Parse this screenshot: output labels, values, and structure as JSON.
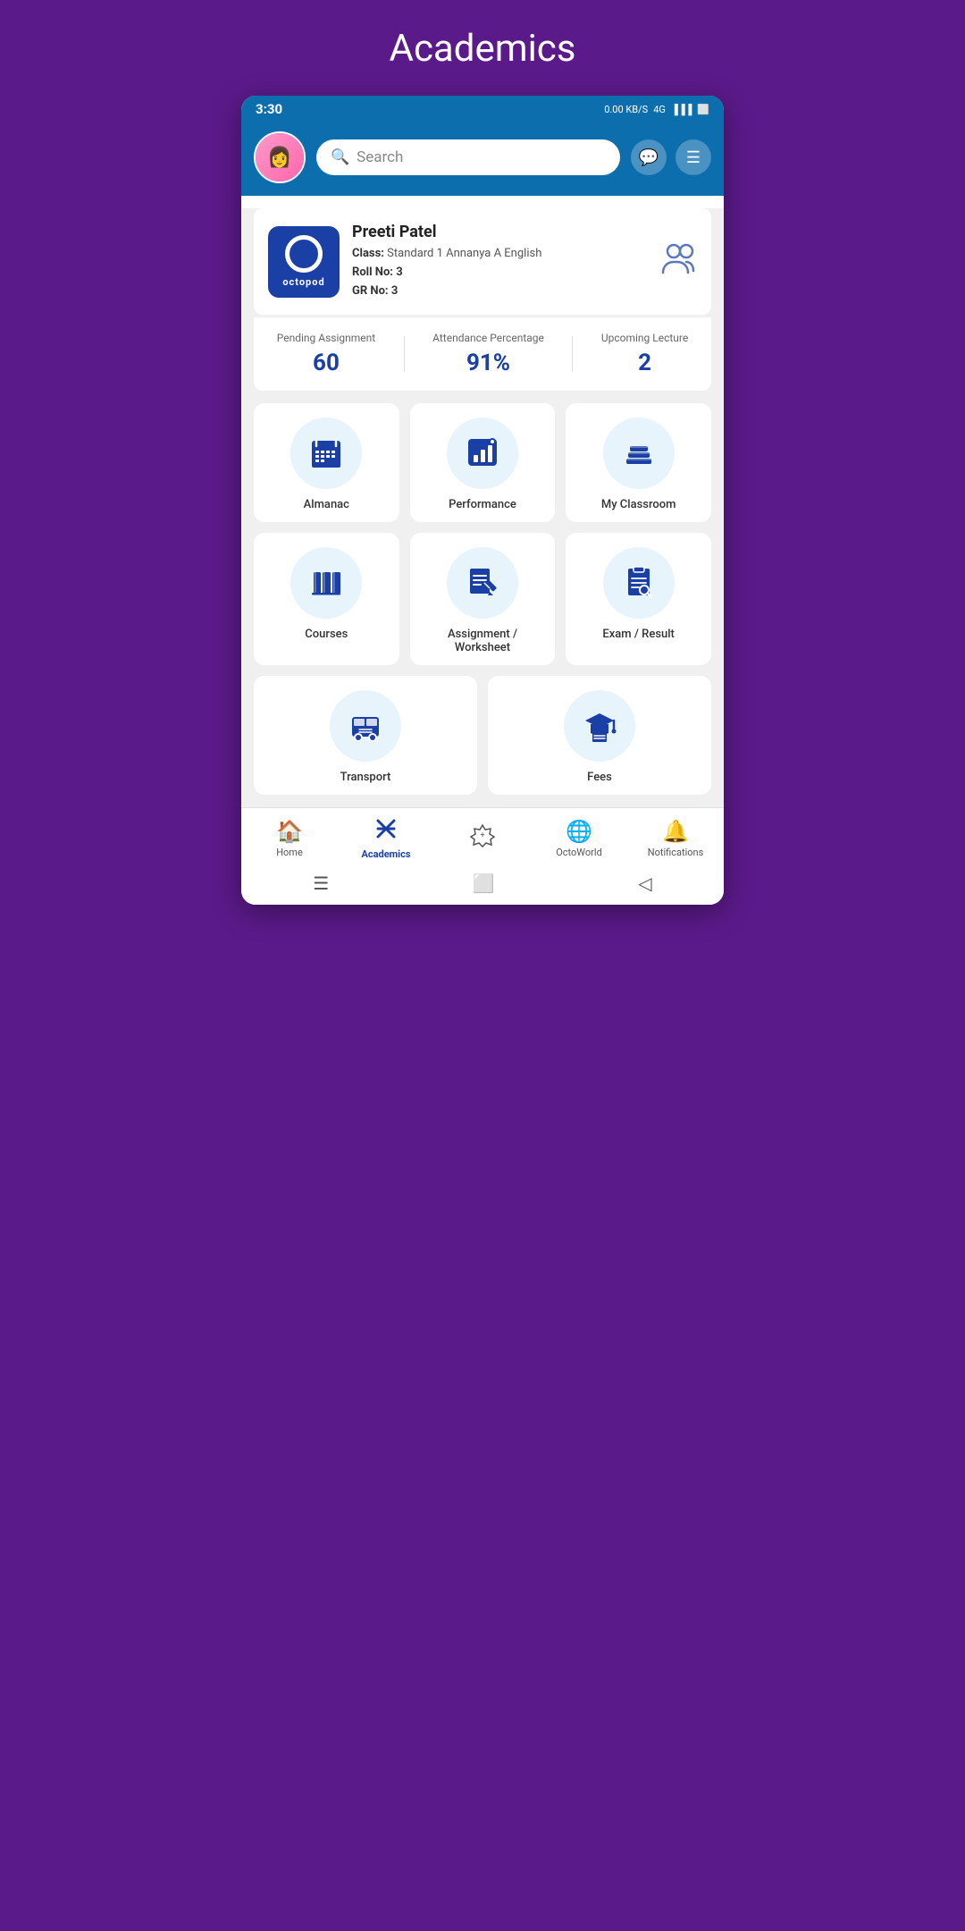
{
  "page": {
    "title": "Academics"
  },
  "status_bar": {
    "time": "3:30",
    "network": "0.00 KB/S",
    "carrier": "4G"
  },
  "header": {
    "search_placeholder": "Search",
    "chat_icon": "💬",
    "menu_icon": "☰"
  },
  "profile": {
    "name": "Preeti Patel",
    "class_label": "Class:",
    "class_value": "Standard 1 Annanya A English",
    "roll_label": "Roll No:",
    "roll_value": "3",
    "gr_label": "GR No:",
    "gr_value": "3",
    "octopod_text": "octopod"
  },
  "stats": [
    {
      "label": "Pending Assignment",
      "value": "60"
    },
    {
      "label": "Attendance Percentage",
      "value": "91%"
    },
    {
      "label": "Upcoming Lecture",
      "value": "2"
    }
  ],
  "grid_items": [
    {
      "label": "Almanac",
      "icon": "almanac"
    },
    {
      "label": "Performance",
      "icon": "performance"
    },
    {
      "label": "My Classroom",
      "icon": "classroom"
    },
    {
      "label": "Courses",
      "icon": "courses"
    },
    {
      "label": "Assignment /\nWorksheet",
      "icon": "assignment"
    },
    {
      "label": "Exam / Result",
      "icon": "exam"
    },
    {
      "label": "Transport",
      "icon": "transport"
    },
    {
      "label": "Fees",
      "icon": "fees"
    }
  ],
  "bottom_nav": [
    {
      "label": "Home",
      "icon": "🏠",
      "active": false
    },
    {
      "label": "Academics",
      "icon": "✏️",
      "active": true
    },
    {
      "label": "",
      "icon": "🛡️",
      "active": false
    },
    {
      "label": "OctoWorld",
      "icon": "🌐",
      "active": false
    },
    {
      "label": "Notifications",
      "icon": "🔔",
      "active": false
    }
  ]
}
